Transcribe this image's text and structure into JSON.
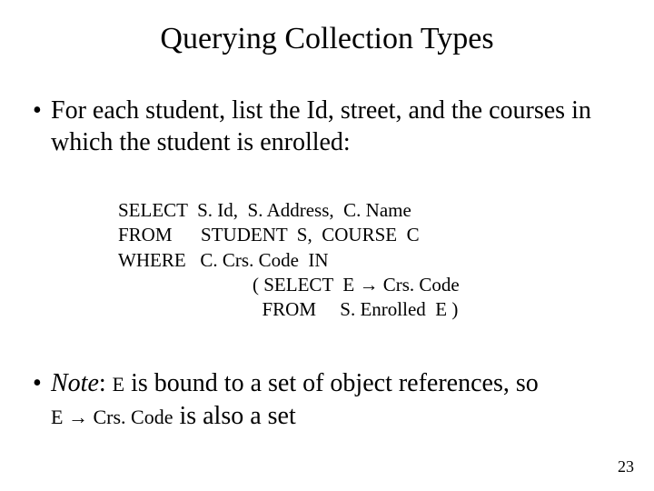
{
  "title": "Querying Collection Types",
  "bullet1": {
    "dot": "•",
    "text": "For each student, list the Id, street, and the courses in which the student is enrolled:"
  },
  "code": {
    "line1_kw": "SELECT",
    "line1_rest": "  S. Id,  S. Address,  C. Name",
    "line2_kw": "FROM",
    "line2_rest": "      STUDENT  S,  COURSE  C",
    "line3_kw": "WHERE",
    "line3_rest": "   C. Crs. Code  IN",
    "line4": "( SELECT  E ",
    "line4_arrow": "→",
    "line4_b": " Crs. Code",
    "line5": "  FROM     S. Enrolled  E )"
  },
  "bullet2": {
    "dot": "•",
    "note": "Note",
    "colon": ":  ",
    "e1": "E",
    "mid": "  is bound to a set of object references, so ",
    "e2": "E ",
    "arrow": "→",
    "after": " Crs. Code",
    "tail": "  is also a set"
  },
  "pagenum": "23"
}
